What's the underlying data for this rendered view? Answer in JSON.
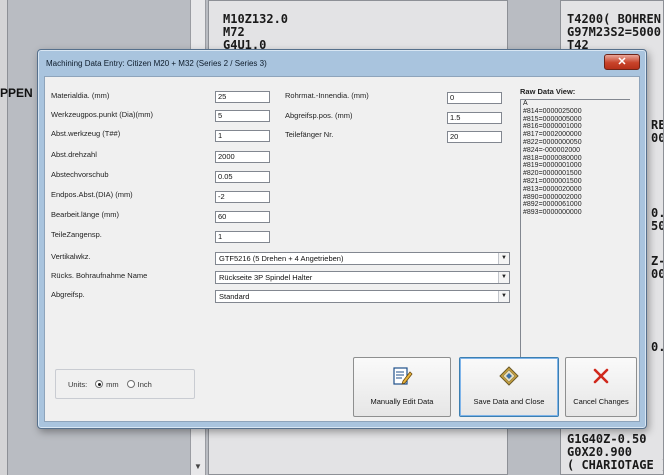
{
  "background": {
    "left_label": "PPEN",
    "code_left_lines": [
      "M10Z132.0",
      "M72",
      "G4U1.0"
    ],
    "code_right_lines": [
      "T4200( BOHREN",
      "G97M23S2=5000",
      "T42"
    ],
    "code_right_fragments": [
      "RE",
      "00",
      "0.5",
      "50",
      "Z-0",
      "000",
      "0.0"
    ],
    "code_right_bottom": [
      "G1G40Z-0.50",
      "G0X20.900",
      "( CHARIOTAGE )"
    ]
  },
  "dialog": {
    "title": "Machining Data Entry:  Citizen M20 + M32 (Series 2 / Series 3)",
    "close_glyph": "✕",
    "fields_left": [
      {
        "label": "Materialdia. (mm)",
        "value": "25"
      },
      {
        "label": "Werkzeugpos.punkt (Dia)(mm)",
        "value": "5"
      },
      {
        "label": "Abst.werkzeug (T##)",
        "value": "1"
      },
      {
        "label": "Abst.drehzahl",
        "value": "2000"
      },
      {
        "label": "Abstechvorschub",
        "value": "0.05"
      },
      {
        "label": "Endpos.Abst.(DIA) (mm)",
        "value": "-2"
      },
      {
        "label": "Bearbeit.länge (mm)",
        "value": "60"
      },
      {
        "label": "TeileZangensp.",
        "value": "1"
      }
    ],
    "fields_right": [
      {
        "label": "Rohrmat.-Innendia. (mm)",
        "value": "0"
      },
      {
        "label": "Abgreifsp.pos. (mm)",
        "value": "1.5"
      },
      {
        "label": "Teilefänger Nr.",
        "value": "20"
      }
    ],
    "combos": [
      {
        "label": "Vertikalwkz.",
        "value": "GTF5216 (5 Drehen + 4 Angetrieben)"
      },
      {
        "label": "Rücks. Bohraufnahme Name",
        "value": "Rückseite 3P Spindel Halter"
      },
      {
        "label": "Abgreifsp.",
        "value": "Standard"
      }
    ],
    "combo_arrow": "▼",
    "raw_title": "Raw Data View:",
    "raw_lines": [
      "A",
      "#814=0000025000",
      "#815=0000005000",
      "#816=0000001000",
      "#817=0002000000",
      "#822=0000000050",
      "#824=-000002000",
      "#818=0000080000",
      "#819=0000001000",
      "#820=0000001500",
      "#821=0000001500",
      "#813=0000020000",
      "#890=0000002000",
      "#892=0000061000",
      "#893=0000000000"
    ],
    "units": {
      "label": "Units:",
      "option_mm": "mm",
      "option_inch": "Inch",
      "selected": "mm"
    },
    "buttons": {
      "manual_edit": "Manually Edit Data",
      "save_close": "Save Data and Close",
      "cancel": "Cancel Changes"
    }
  }
}
